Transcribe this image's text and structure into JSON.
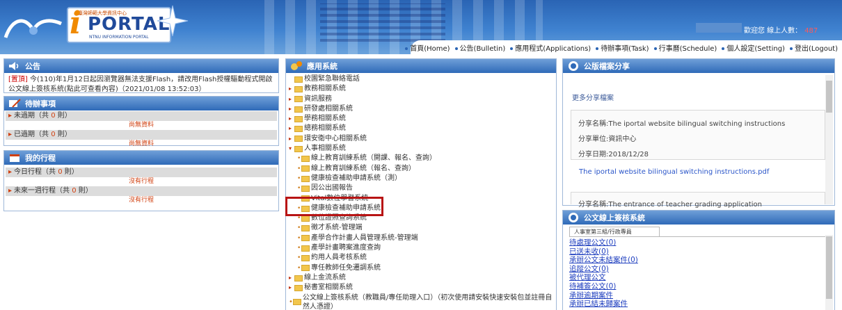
{
  "header": {
    "logo_sub": "臺灣師範大學資訊中心",
    "logo_i": "i",
    "logo_portal": "PORTAL",
    "logo_ntnu": "NTNU INFORMATION PORTAL",
    "welcome": "歡迎您 線上人數：",
    "online_count": "487"
  },
  "nav": [
    "首頁(Home)",
    "公告(Bulletin)",
    "應用程式(Applications)",
    "待辦事項(Task)",
    "行事曆(Schedule)",
    "個人設定(Setting)",
    "登出(Logout)"
  ],
  "announce": {
    "title": "公告",
    "tag": "[置頂]",
    "text": " 今(110)年1月12日起因瀏覽器無法支援Flash，請改用Flash授權驅動程式開啟公文線上簽核系統(點此可查看內容)（2021/01/08 13:52:03）"
  },
  "todo": {
    "title": "待辦事項",
    "rows": [
      {
        "pre": "未過期（共 ",
        "num": "0",
        "post": " 則）",
        "empty": "尚無資料"
      },
      {
        "pre": "已過期（共 ",
        "num": "0",
        "post": " 則）",
        "empty": "尚無資料"
      }
    ]
  },
  "schedule": {
    "title": "我的行程",
    "rows": [
      {
        "pre": "今日行程（共 ",
        "num": "0",
        "post": " 則）",
        "empty": "沒有行程"
      },
      {
        "pre": "未來一週行程（共 ",
        "num": "0",
        "post": " 則）",
        "empty": "沒有行程"
      }
    ]
  },
  "apps": {
    "title": "應用系統",
    "top": [
      "校園緊急聯絡電話",
      "教務相關系統",
      "資訊服務",
      "研發處相關系統",
      "學務相關系統",
      "總務相關系統",
      "環安衛中心相關系統",
      "人事相關系統"
    ],
    "hr_sub": [
      "線上教育訓練系統（開課、報名、查詢）",
      "線上教育訓練系統（報名、查詢）",
      "健康檢查補助申請系統（測）",
      "因公出國報告",
      "Vital數位學習系統",
      "健康檢查補助申請系統",
      "數位證照查詢系統",
      "徵才系統-管理端",
      "產學合作計畫人員管理系統-管理端",
      "產學計畫聘案進度查詢",
      "約用人員考核系統",
      "專任教師任免遷調系統"
    ],
    "bottom": [
      "線上金流系統",
      "秘書室相關系統",
      "公文線上簽核系統（教職員/專任助理入口）（初次使用請安裝快速安裝包並註冊自然人憑證）"
    ]
  },
  "share": {
    "title": "公版檔案分享",
    "more": "更多分享檔案",
    "card1": {
      "name": "分享名稱:The iportal website bilingual switching instructions",
      "unit": "分享單位:資訊中心",
      "date": "分享日期:2018/12/28"
    },
    "link1": "The iportal website bilingual switching instructions.pdf",
    "card2": {
      "name": "分享名稱:The entrance of teacher grading application"
    }
  },
  "doc": {
    "title": "公文線上簽核系統",
    "tab": "人事室第三組/行政專員",
    "links": [
      "待處理公文(0)",
      "已送未收(0)",
      "承辦公文未結案件(0)",
      "追蹤公文(0)",
      "被代理公文",
      "待補簽公文(0)",
      "承辦逾期案件",
      "承辦已結未歸案件"
    ]
  },
  "colors": {
    "header_blue": "#2a64b4",
    "panel_title": "#2f6ab8",
    "link_blue": "#1f3fbf",
    "highlight_red": "#b81414",
    "count_red": "#ff5a5a"
  }
}
